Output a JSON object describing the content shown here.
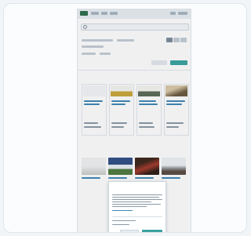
{
  "colors": {
    "accent": "#3d86b5",
    "brand_green": "#2e6e4a",
    "button_teal": "#3aa3a0",
    "section_title": "#2b6d8f"
  },
  "icons": {
    "logo": "brand-logo",
    "search": "search-icon"
  },
  "sections": {
    "first": {
      "title": ""
    },
    "second": {
      "title": ""
    }
  },
  "modal": {
    "title": ""
  },
  "note": ""
}
